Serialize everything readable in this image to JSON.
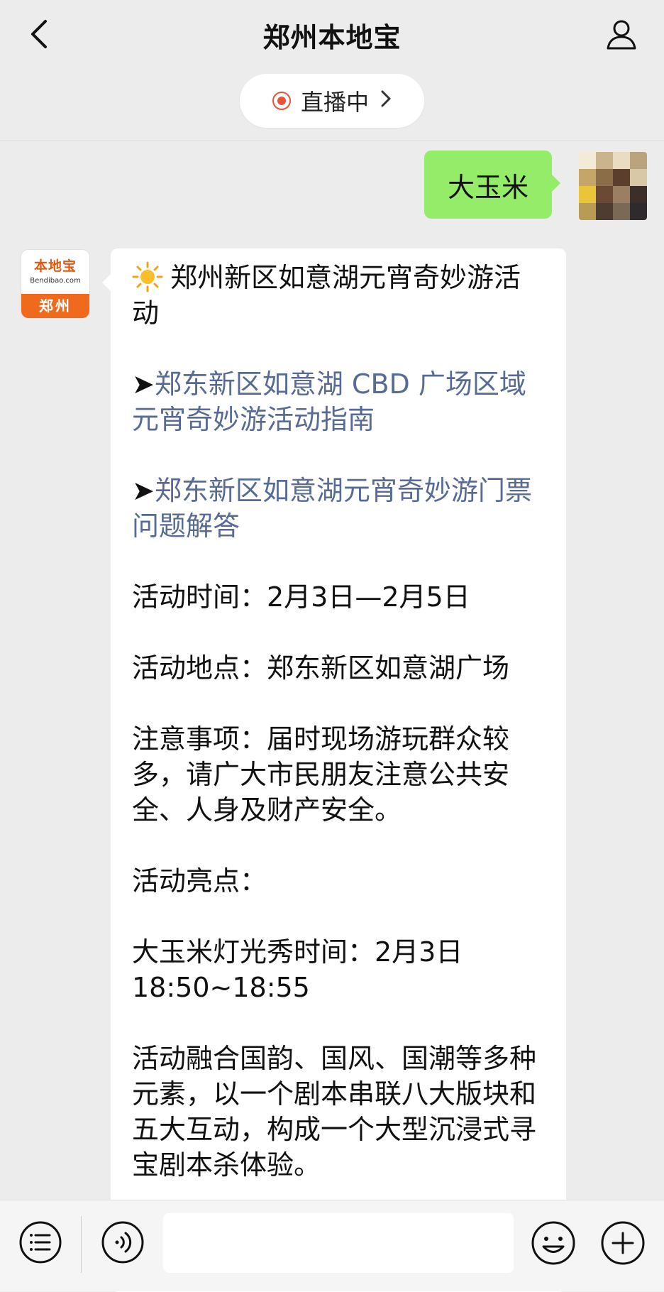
{
  "header": {
    "title": "郑州本地宝",
    "back_icon": "chevron-left-icon",
    "profile_icon": "user-icon",
    "live_label": "直播中"
  },
  "messages": {
    "outgoing": {
      "text": "大玉米"
    },
    "incoming": {
      "avatar": {
        "logo_text": "本地宝",
        "logo_sub": "Bendibao.com",
        "city": "郑州"
      },
      "heading": "郑州新区如意湖元宵奇妙游活动",
      "link_arrow": "➤",
      "link1": "郑东新区如意湖 CBD 广场区域元宵奇妙游活动指南",
      "link2": "郑东新区如意湖元宵奇妙游门票问题解答",
      "time": "活动时间：2月3日—2月5日",
      "place": "活动地点：郑东新区如意湖广场",
      "notice": "注意事项：届时现场游玩群众较多，请广大市民朋友注意公共安全、人身及财产安全。",
      "highlights": "活动亮点：",
      "show_time": "大玉米灯光秀时间：2月3日 18:50~18:55",
      "desc": "活动融合国韵、国风、国潮等多种元素，以一个剧本串联八大版块和五大互动，构成一个大型沉浸式寻宝剧本杀体验。"
    }
  },
  "input_bar": {
    "menu_icon": "menu-list-icon",
    "voice_icon": "voice-icon",
    "input_value": "",
    "emoji_icon": "emoji-icon",
    "plus_icon": "plus-icon"
  },
  "colors": {
    "outgoing_bubble": "#95ec69",
    "link": "#576b95",
    "live_dot": "#e8533b",
    "brand_orange": "#f06a1e"
  }
}
